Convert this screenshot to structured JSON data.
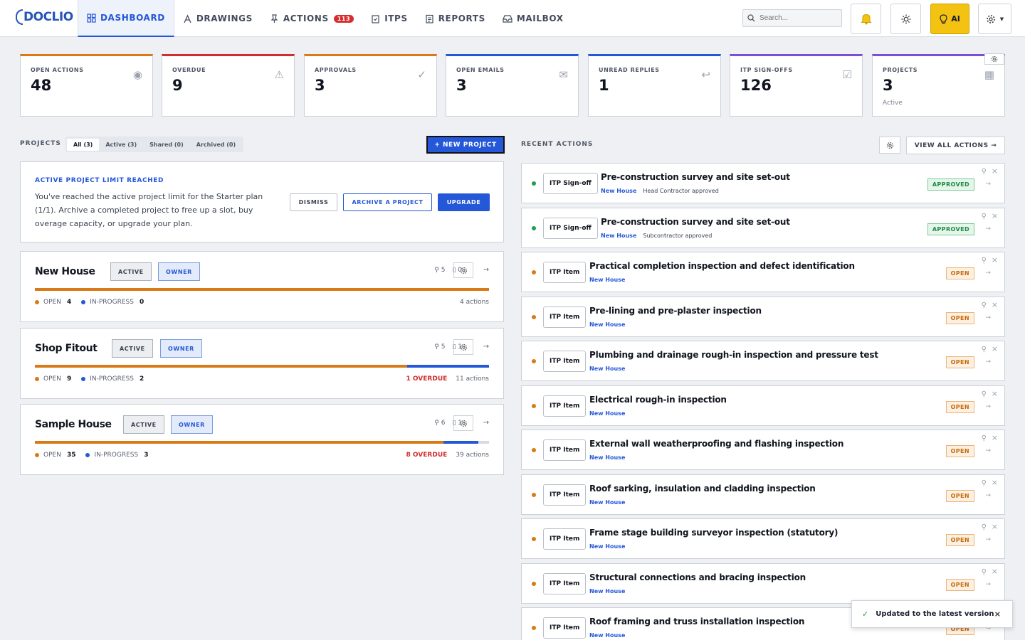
{
  "app": {
    "logo": "DOCLIO"
  },
  "nav": {
    "tabs": [
      {
        "label": "DASHBOARD",
        "icon": "grid-icon",
        "active": true
      },
      {
        "label": "DRAWINGS",
        "icon": "compass-icon"
      },
      {
        "label": "ACTIONS",
        "icon": "pin-icon",
        "badge": "113"
      },
      {
        "label": "ITPS",
        "icon": "clipboard-icon"
      },
      {
        "label": "REPORTS",
        "icon": "report-icon"
      },
      {
        "label": "MAILBOX",
        "icon": "inbox-icon"
      }
    ],
    "search_placeholder": "Search...",
    "ai_label": "AI"
  },
  "stats": [
    {
      "label": "OPEN ACTIONS",
      "value": "48",
      "icon": "target-icon",
      "color": "#d97a16"
    },
    {
      "label": "OVERDUE",
      "value": "9",
      "icon": "warning-icon",
      "color": "#d22c2c"
    },
    {
      "label": "APPROVALS",
      "value": "3",
      "icon": "check-icon",
      "color": "#d97a16"
    },
    {
      "label": "OPEN EMAILS",
      "value": "3",
      "icon": "mail-icon",
      "color": "#2458d8"
    },
    {
      "label": "UNREAD REPLIES",
      "value": "1",
      "icon": "reply-icon",
      "color": "#2458d8"
    },
    {
      "label": "ITP SIGN-OFFS",
      "value": "126",
      "icon": "checkbox-icon",
      "color": "#7b4fd6"
    },
    {
      "label": "PROJECTS",
      "value": "3",
      "sub": "Active",
      "icon": "building-icon",
      "color": "#7b4fd6"
    }
  ],
  "projects": {
    "section_label": "PROJECTS",
    "filters": [
      "All (3)",
      "Active (3)",
      "Shared (0)",
      "Archived (0)"
    ],
    "new_label": "+ NEW PROJECT",
    "limit": {
      "title": "ACTIVE PROJECT LIMIT REACHED",
      "text": "You've reached the active project limit for the Starter plan (1/1). Archive a completed project to free up a slot, buy overage capacity, or upgrade your plan.",
      "dismiss": "DISMISS",
      "archive": "ARCHIVE A PROJECT",
      "upgrade": "UPGRADE"
    },
    "open_label": "OPEN",
    "inprogress_label": "IN-PROGRESS",
    "items": [
      {
        "name": "New House",
        "status": "ACTIVE",
        "role": "OWNER",
        "members": "5",
        "docs": "0",
        "open": "4",
        "inprogress": "0",
        "open_pct": 100,
        "inprogress_pct": 0,
        "overdue": "",
        "actions": "4 actions"
      },
      {
        "name": "Shop Fitout",
        "status": "ACTIVE",
        "role": "OWNER",
        "members": "5",
        "docs": "1",
        "open": "9",
        "inprogress": "2",
        "open_pct": 82,
        "inprogress_pct": 18,
        "overdue": "1 OVERDUE",
        "actions": "11 actions"
      },
      {
        "name": "Sample House",
        "status": "ACTIVE",
        "role": "OWNER",
        "members": "6",
        "docs": "1",
        "open": "35",
        "inprogress": "3",
        "open_pct": 90,
        "inprogress_pct": 7.7,
        "overdue": "8 OVERDUE",
        "actions": "39 actions"
      }
    ]
  },
  "recent": {
    "section_label": "RECENT ACTIONS",
    "view_all": "VIEW ALL ACTIONS →",
    "items": [
      {
        "type": "ITP Sign-off",
        "title": "Pre-construction survey and site set-out",
        "project": "New House",
        "note": "Head Contractor approved",
        "status": "APPROVED",
        "dot": "#1e9e4a"
      },
      {
        "type": "ITP Sign-off",
        "title": "Pre-construction survey and site set-out",
        "project": "New House",
        "note": "Subcontractor approved",
        "status": "APPROVED",
        "dot": "#1e9e4a"
      },
      {
        "type": "ITP Item",
        "title": "Practical completion inspection and defect identification",
        "project": "New House",
        "note": "",
        "status": "OPEN",
        "dot": "#d97a16"
      },
      {
        "type": "ITP Item",
        "title": "Pre-lining and pre-plaster inspection",
        "project": "New House",
        "note": "",
        "status": "OPEN",
        "dot": "#d97a16"
      },
      {
        "type": "ITP Item",
        "title": "Plumbing and drainage rough-in inspection and pressure test",
        "project": "New House",
        "note": "",
        "status": "OPEN",
        "dot": "#d97a16"
      },
      {
        "type": "ITP Item",
        "title": "Electrical rough-in inspection",
        "project": "New House",
        "note": "",
        "status": "OPEN",
        "dot": "#d97a16"
      },
      {
        "type": "ITP Item",
        "title": "External wall weatherproofing and flashing inspection",
        "project": "New House",
        "note": "",
        "status": "OPEN",
        "dot": "#d97a16"
      },
      {
        "type": "ITP Item",
        "title": "Roof sarking, insulation and cladding inspection",
        "project": "New House",
        "note": "",
        "status": "OPEN",
        "dot": "#d97a16"
      },
      {
        "type": "ITP Item",
        "title": "Frame stage building surveyor inspection (statutory)",
        "project": "New House",
        "note": "",
        "status": "OPEN",
        "dot": "#d97a16"
      },
      {
        "type": "ITP Item",
        "title": "Structural connections and bracing inspection",
        "project": "New House",
        "note": "",
        "status": "OPEN",
        "dot": "#d97a16"
      },
      {
        "type": "ITP Item",
        "title": "Roof framing and truss installation inspection",
        "project": "New House",
        "note": "",
        "status": "OPEN",
        "dot": "#d97a16"
      }
    ]
  },
  "toast": {
    "text": "Updated to the latest version"
  }
}
